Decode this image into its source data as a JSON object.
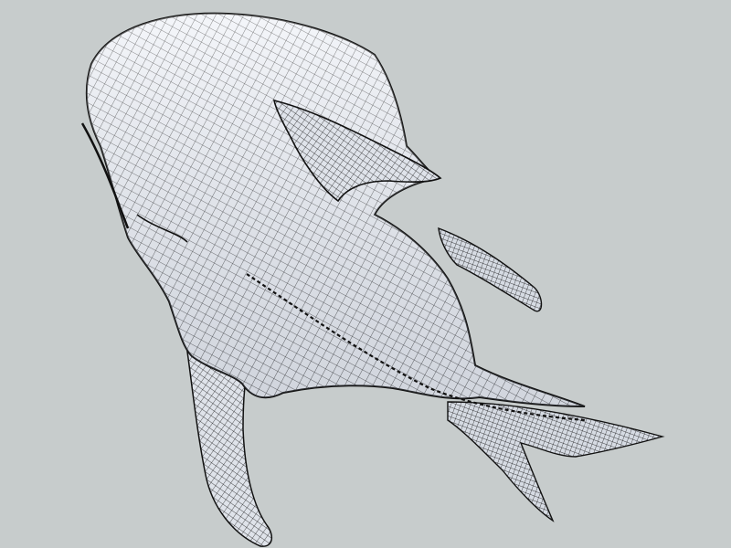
{
  "viewport": {
    "background": "#c7cccc",
    "mesh_fill": "#eef1f7",
    "mesh_line": "#111111"
  },
  "model": {
    "subject": "whale-shark-wireframe",
    "render_style": "wireframe-mesh"
  }
}
